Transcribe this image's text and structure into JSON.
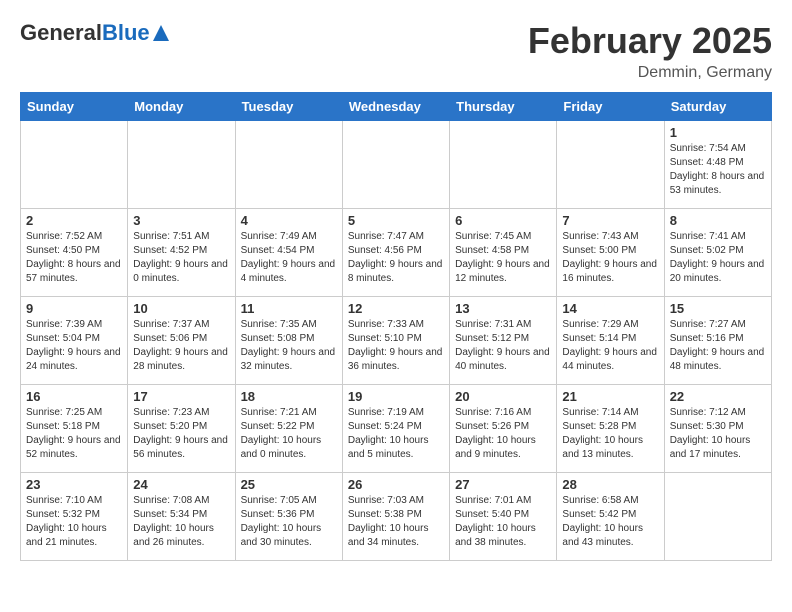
{
  "logo": {
    "general": "General",
    "blue": "Blue"
  },
  "header": {
    "month": "February 2025",
    "location": "Demmin, Germany"
  },
  "weekdays": [
    "Sunday",
    "Monday",
    "Tuesday",
    "Wednesday",
    "Thursday",
    "Friday",
    "Saturday"
  ],
  "weeks": [
    [
      {
        "day": "",
        "info": ""
      },
      {
        "day": "",
        "info": ""
      },
      {
        "day": "",
        "info": ""
      },
      {
        "day": "",
        "info": ""
      },
      {
        "day": "",
        "info": ""
      },
      {
        "day": "",
        "info": ""
      },
      {
        "day": "1",
        "info": "Sunrise: 7:54 AM\nSunset: 4:48 PM\nDaylight: 8 hours and 53 minutes."
      }
    ],
    [
      {
        "day": "2",
        "info": "Sunrise: 7:52 AM\nSunset: 4:50 PM\nDaylight: 8 hours and 57 minutes."
      },
      {
        "day": "3",
        "info": "Sunrise: 7:51 AM\nSunset: 4:52 PM\nDaylight: 9 hours and 0 minutes."
      },
      {
        "day": "4",
        "info": "Sunrise: 7:49 AM\nSunset: 4:54 PM\nDaylight: 9 hours and 4 minutes."
      },
      {
        "day": "5",
        "info": "Sunrise: 7:47 AM\nSunset: 4:56 PM\nDaylight: 9 hours and 8 minutes."
      },
      {
        "day": "6",
        "info": "Sunrise: 7:45 AM\nSunset: 4:58 PM\nDaylight: 9 hours and 12 minutes."
      },
      {
        "day": "7",
        "info": "Sunrise: 7:43 AM\nSunset: 5:00 PM\nDaylight: 9 hours and 16 minutes."
      },
      {
        "day": "8",
        "info": "Sunrise: 7:41 AM\nSunset: 5:02 PM\nDaylight: 9 hours and 20 minutes."
      }
    ],
    [
      {
        "day": "9",
        "info": "Sunrise: 7:39 AM\nSunset: 5:04 PM\nDaylight: 9 hours and 24 minutes."
      },
      {
        "day": "10",
        "info": "Sunrise: 7:37 AM\nSunset: 5:06 PM\nDaylight: 9 hours and 28 minutes."
      },
      {
        "day": "11",
        "info": "Sunrise: 7:35 AM\nSunset: 5:08 PM\nDaylight: 9 hours and 32 minutes."
      },
      {
        "day": "12",
        "info": "Sunrise: 7:33 AM\nSunset: 5:10 PM\nDaylight: 9 hours and 36 minutes."
      },
      {
        "day": "13",
        "info": "Sunrise: 7:31 AM\nSunset: 5:12 PM\nDaylight: 9 hours and 40 minutes."
      },
      {
        "day": "14",
        "info": "Sunrise: 7:29 AM\nSunset: 5:14 PM\nDaylight: 9 hours and 44 minutes."
      },
      {
        "day": "15",
        "info": "Sunrise: 7:27 AM\nSunset: 5:16 PM\nDaylight: 9 hours and 48 minutes."
      }
    ],
    [
      {
        "day": "16",
        "info": "Sunrise: 7:25 AM\nSunset: 5:18 PM\nDaylight: 9 hours and 52 minutes."
      },
      {
        "day": "17",
        "info": "Sunrise: 7:23 AM\nSunset: 5:20 PM\nDaylight: 9 hours and 56 minutes."
      },
      {
        "day": "18",
        "info": "Sunrise: 7:21 AM\nSunset: 5:22 PM\nDaylight: 10 hours and 0 minutes."
      },
      {
        "day": "19",
        "info": "Sunrise: 7:19 AM\nSunset: 5:24 PM\nDaylight: 10 hours and 5 minutes."
      },
      {
        "day": "20",
        "info": "Sunrise: 7:16 AM\nSunset: 5:26 PM\nDaylight: 10 hours and 9 minutes."
      },
      {
        "day": "21",
        "info": "Sunrise: 7:14 AM\nSunset: 5:28 PM\nDaylight: 10 hours and 13 minutes."
      },
      {
        "day": "22",
        "info": "Sunrise: 7:12 AM\nSunset: 5:30 PM\nDaylight: 10 hours and 17 minutes."
      }
    ],
    [
      {
        "day": "23",
        "info": "Sunrise: 7:10 AM\nSunset: 5:32 PM\nDaylight: 10 hours and 21 minutes."
      },
      {
        "day": "24",
        "info": "Sunrise: 7:08 AM\nSunset: 5:34 PM\nDaylight: 10 hours and 26 minutes."
      },
      {
        "day": "25",
        "info": "Sunrise: 7:05 AM\nSunset: 5:36 PM\nDaylight: 10 hours and 30 minutes."
      },
      {
        "day": "26",
        "info": "Sunrise: 7:03 AM\nSunset: 5:38 PM\nDaylight: 10 hours and 34 minutes."
      },
      {
        "day": "27",
        "info": "Sunrise: 7:01 AM\nSunset: 5:40 PM\nDaylight: 10 hours and 38 minutes."
      },
      {
        "day": "28",
        "info": "Sunrise: 6:58 AM\nSunset: 5:42 PM\nDaylight: 10 hours and 43 minutes."
      },
      {
        "day": "",
        "info": ""
      }
    ]
  ]
}
